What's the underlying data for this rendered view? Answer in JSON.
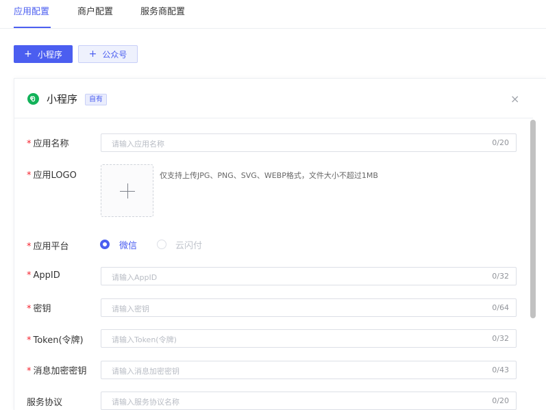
{
  "tabs": [
    {
      "label": "应用配置",
      "active": true
    },
    {
      "label": "商户配置",
      "active": false
    },
    {
      "label": "服务商配置",
      "active": false
    }
  ],
  "buttons": {
    "mini_program": "小程序",
    "official_account": "公众号"
  },
  "card": {
    "title": "小程序",
    "badge": "自有",
    "close": "×"
  },
  "form": {
    "app_name": {
      "label": "应用名称",
      "required": "*",
      "placeholder": "请输入应用名称",
      "count": "0/20"
    },
    "app_logo": {
      "label": "应用LOGO",
      "required": "*",
      "tip": "仅支持上传JPG、PNG、SVG、WEBP格式，文件大小不超过1MB"
    },
    "platform": {
      "label": "应用平台",
      "required": "*",
      "options": [
        "微信",
        "云闪付"
      ],
      "selected": "微信"
    },
    "appid": {
      "label": "AppID",
      "required": "*",
      "placeholder": "请输入AppID",
      "count": "0/32"
    },
    "secret": {
      "label": "密钥",
      "required": "*",
      "placeholder": "请输入密钥",
      "count": "0/64"
    },
    "token": {
      "label": "Token(令牌)",
      "required": "*",
      "placeholder": "请输入Token(令牌)",
      "count": "0/32"
    },
    "msg_key": {
      "label": "消息加密密钥",
      "required": "*",
      "placeholder": "请输入消息加密密钥",
      "count": "0/43"
    },
    "agreement": {
      "label": "服务协议",
      "placeholder": "请输入服务协议名称",
      "count": "0/20"
    }
  },
  "colors": {
    "accent": "#4b5ef0",
    "required": "#f5222d",
    "wechat_green": "#12b259"
  },
  "icons": {
    "add": "plus-icon",
    "close": "close-icon",
    "mini_program": "mini-program-logo-icon"
  }
}
